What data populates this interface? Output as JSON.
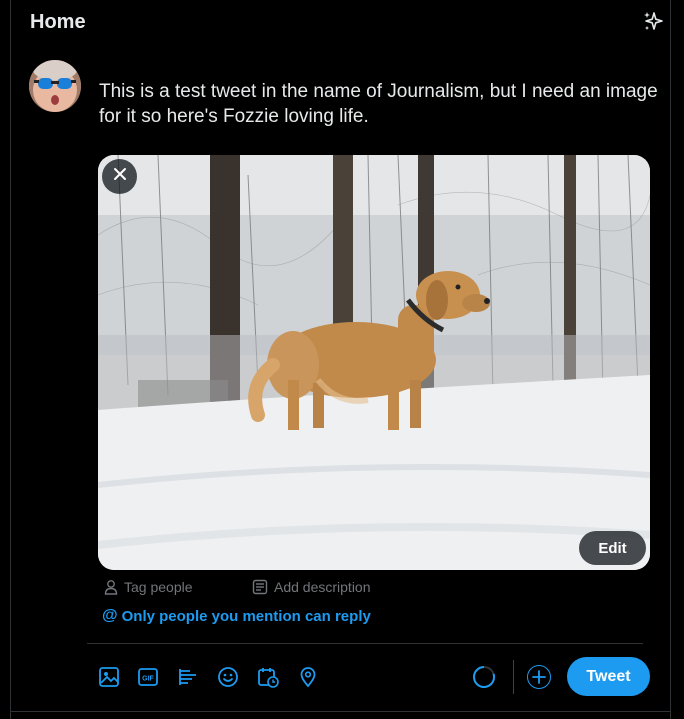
{
  "header": {
    "title": "Home",
    "sparkle_icon": "sparkle-icon"
  },
  "composer": {
    "text": "This is a test tweet in the name of Journalism, but I need an image for it so here's Fozzie loving life.",
    "media": {
      "alt": "Golden retriever standing in snowy woods",
      "close_icon": "close-icon",
      "edit_label": "Edit"
    },
    "media_actions": {
      "tag_people": "Tag people",
      "add_description": "Add description"
    },
    "reply_setting": "Only people you mention can reply"
  },
  "toolbar": {
    "icons": [
      "image-icon",
      "gif-icon",
      "poll-icon",
      "emoji-icon",
      "schedule-icon",
      "location-icon"
    ],
    "gif_label": "GIF",
    "tweet_label": "Tweet"
  },
  "colors": {
    "accent": "#1d9bf0",
    "background": "#000000",
    "text": "#e7e9ea",
    "muted": "#71767b"
  }
}
